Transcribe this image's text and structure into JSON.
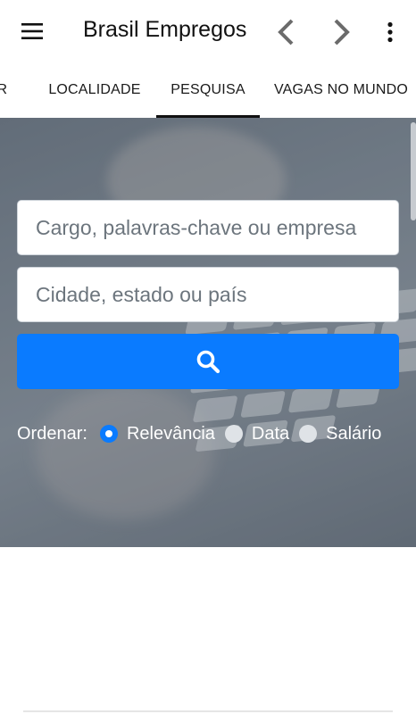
{
  "appbar": {
    "title": "Brasil Empregos",
    "menu_icon": "hamburger-menu-icon",
    "back_icon": "chevron-left-icon",
    "forward_icon": "chevron-right-icon",
    "more_icon": "more-vert-icon"
  },
  "tabs": {
    "items": [
      {
        "label": "OR"
      },
      {
        "label": "LOCALIDADE"
      },
      {
        "label": "PESQUISA"
      },
      {
        "label": "VAGAS NO MUNDO"
      }
    ],
    "active": "PESQUISA"
  },
  "search": {
    "keywords_placeholder": "Cargo, palavras-chave ou empresa",
    "location_placeholder": "Cidade, estado ou país",
    "button_icon": "search-icon"
  },
  "sort": {
    "label": "Ordenar:",
    "options": [
      {
        "label": "Relevância",
        "checked": true
      },
      {
        "label": "Data",
        "checked": false
      },
      {
        "label": "Salário",
        "checked": false
      }
    ]
  },
  "colors": {
    "primary": "#0a7bff",
    "text_dark": "#111111",
    "placeholder": "#6c757d"
  }
}
